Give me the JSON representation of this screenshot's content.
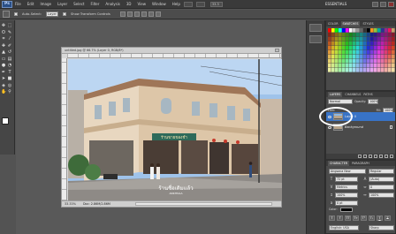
{
  "app": {
    "logo": "Ps",
    "menu": [
      "File",
      "Edit",
      "Image",
      "Layer",
      "Select",
      "Filter",
      "Analysis",
      "3D",
      "View",
      "Window",
      "Help"
    ],
    "zoom": "33.3",
    "workspace": "ESSENTIALS"
  },
  "options_bar": {
    "auto_select_label": "Auto-Select:",
    "auto_select_value": "Layer",
    "transform_label": "Show Transform Controls"
  },
  "document": {
    "title": "untitled.jpg @ 66.7% (Layer 0, RGB/8*)",
    "zoom_status": "33.33%",
    "doc_size": "Doc: 2.86M/2.86M",
    "photo": {
      "shop_sign": "ร้านขายของชำ",
      "bottom_caption": "ร้านชื่อเดิมแล้ว",
      "bottom_caption_sub": "ANKHSILA"
    }
  },
  "panels": {
    "color_tabs": [
      "COLOR",
      "SWATCHES",
      "STYLES"
    ],
    "layers_tabs": [
      "LAYERS",
      "CHANNELS",
      "PATHS"
    ],
    "blend_mode": "Normal",
    "opacity_label": "Opacity:",
    "opacity": "100%",
    "fill_label": "Fill:",
    "fill": "100%",
    "lock_label": "Lock:",
    "layers": [
      {
        "name": "Layer 0",
        "selected": true
      },
      {
        "name": "Background",
        "selected": false
      }
    ],
    "char_tabs": [
      "CHARACTER",
      "PARAGRAPH"
    ],
    "font_family": "Angsana New",
    "font_style": "Regular",
    "font_size": "72 pt",
    "leading": "(Auto)",
    "kerning": "Metrics",
    "tracking": "0",
    "vscale": "100%",
    "hscale": "100%",
    "baseline": "0 pt",
    "color_label": "Color:",
    "language": "English: USA",
    "antialias": "Sharp"
  },
  "colors": {
    "selected_layer": "#3873c6",
    "panel_bg": "#4a4a4a",
    "workspace_bg": "#595959"
  }
}
